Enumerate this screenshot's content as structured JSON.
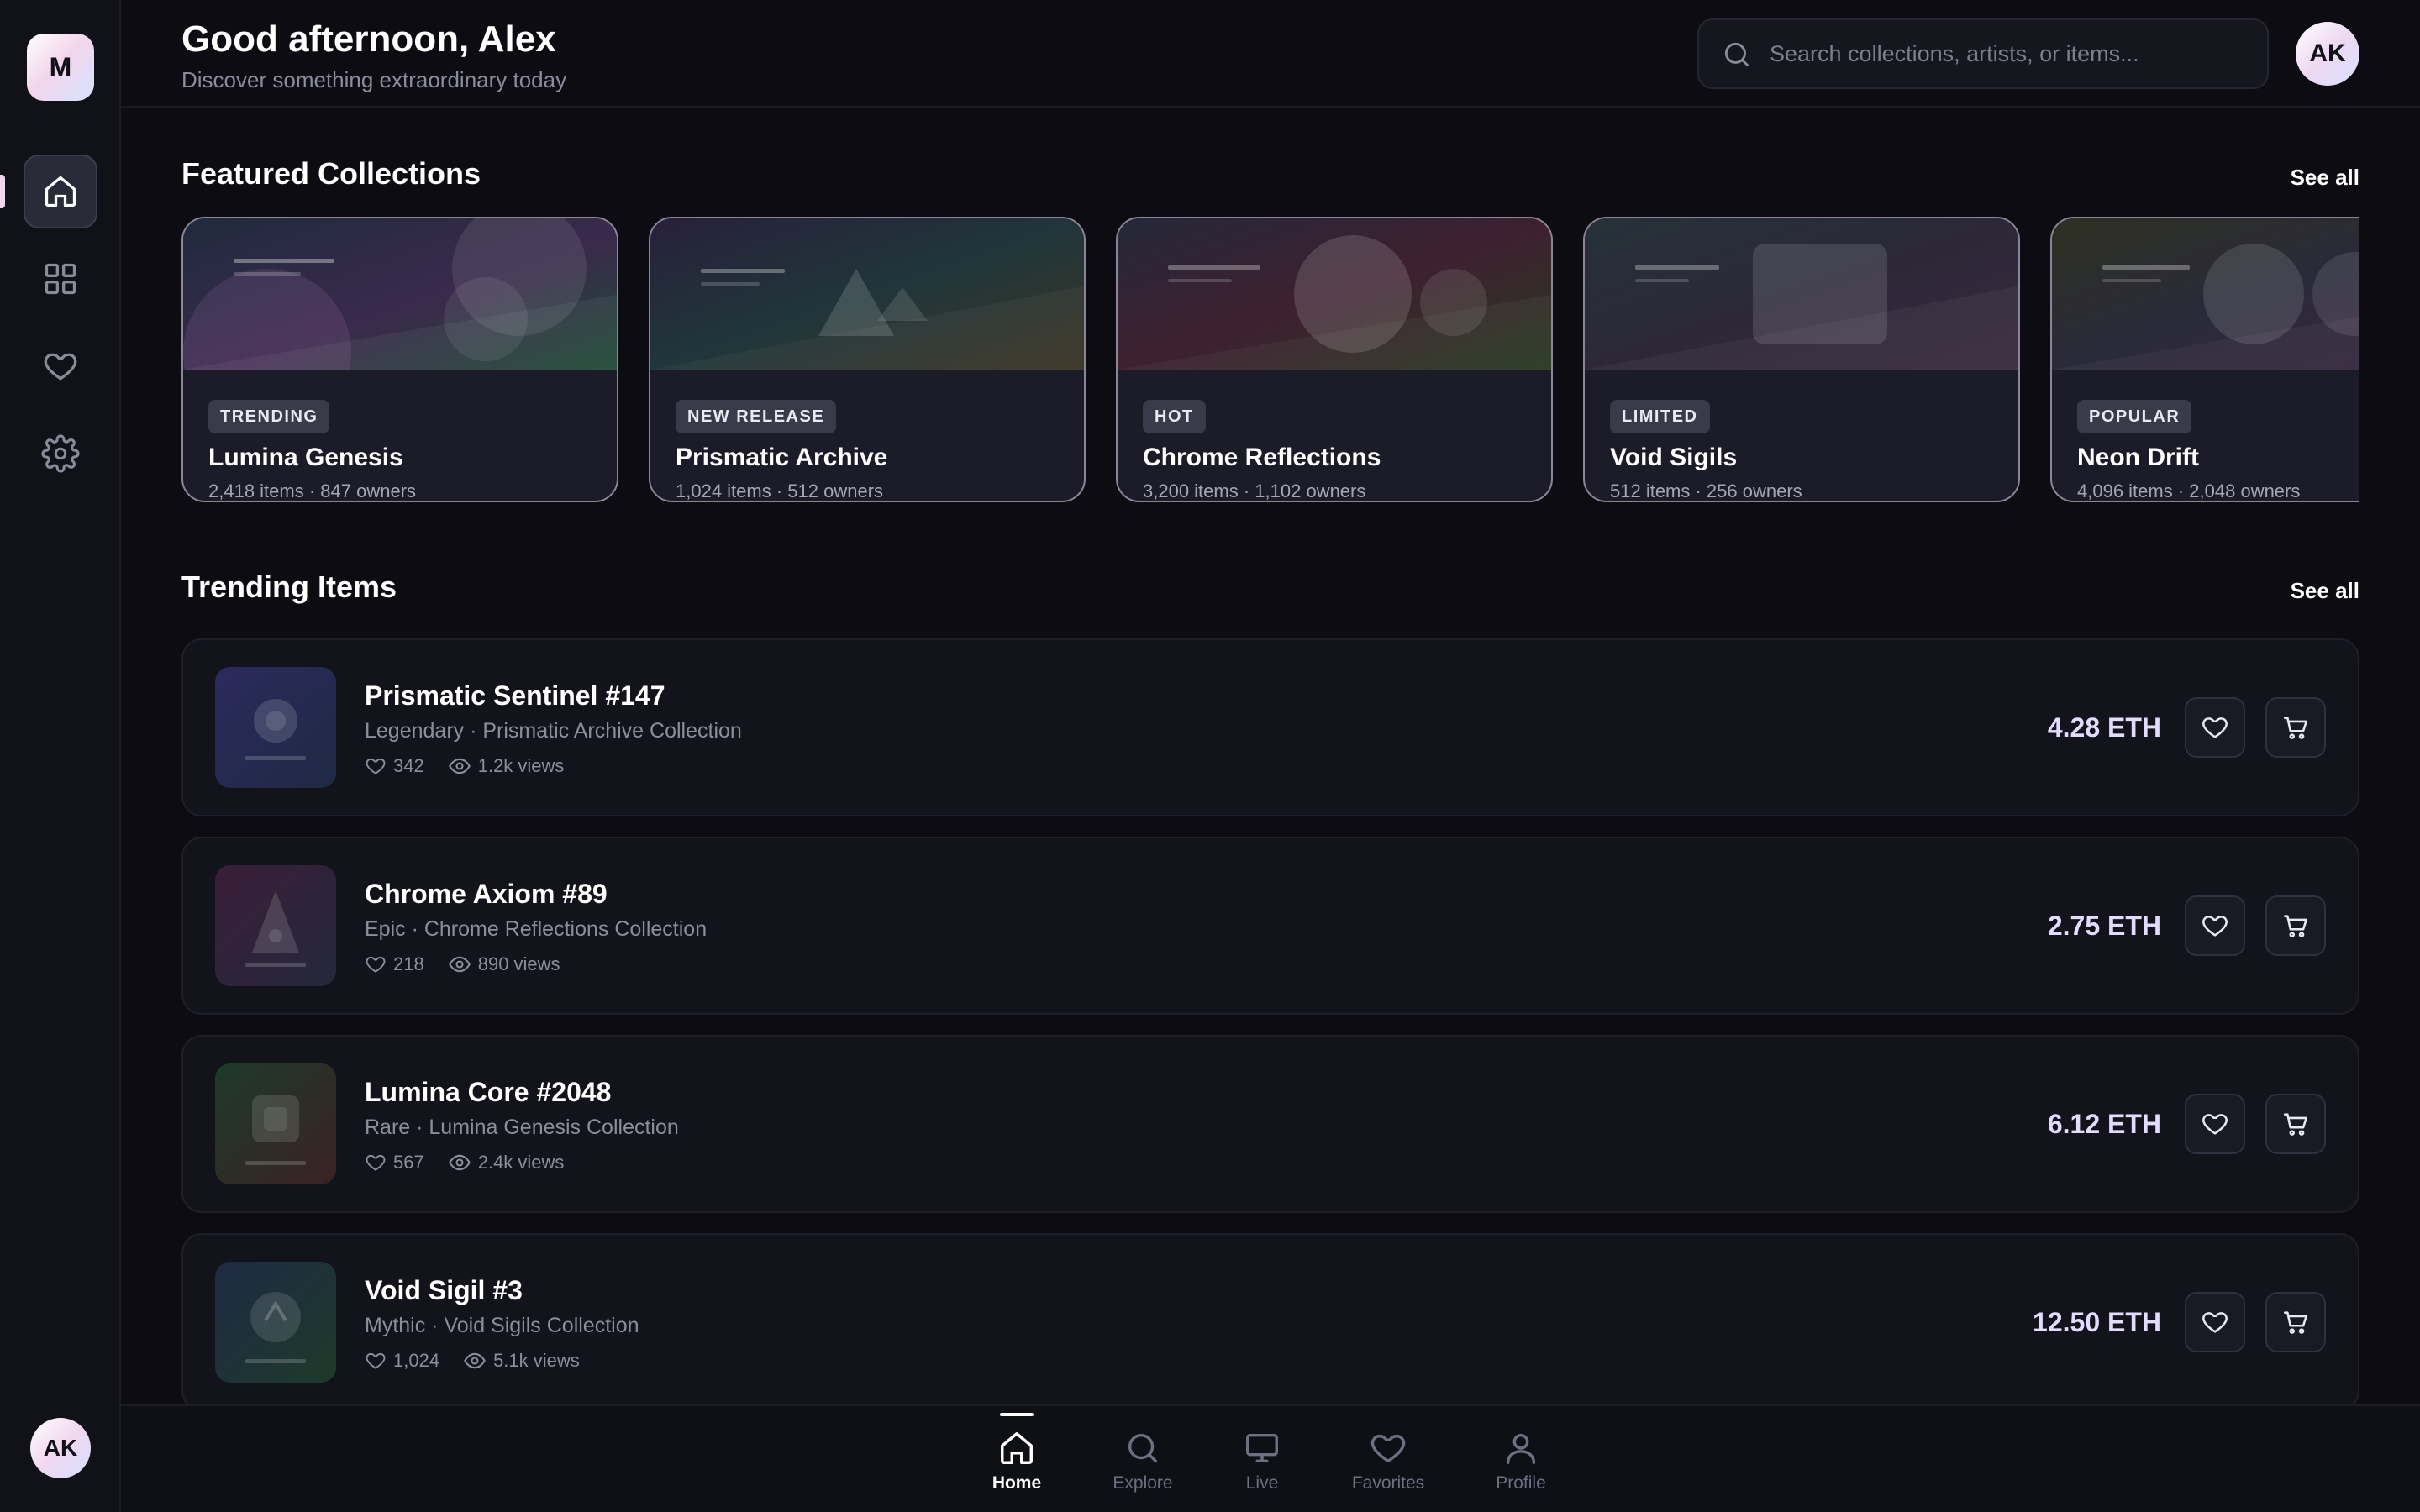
{
  "app": {
    "logo_letter": "M"
  },
  "header": {
    "greeting": "Good afternoon, Alex",
    "subtitle": "Discover something extraordinary today",
    "search_placeholder": "Search collections, artists, or items...",
    "avatar_initials": "AK"
  },
  "sidebar": {
    "items": [
      {
        "icon": "home-icon",
        "active": true
      },
      {
        "icon": "grid-icon",
        "active": false
      },
      {
        "icon": "heart-icon",
        "active": false
      },
      {
        "icon": "gear-icon",
        "active": false
      }
    ],
    "avatar_initials": "AK"
  },
  "featured": {
    "title": "Featured Collections",
    "see_all": "See all",
    "collections": [
      {
        "badge": "TRENDING",
        "name": "Lumina Genesis",
        "meta": "2,418 items · 847 owners"
      },
      {
        "badge": "NEW RELEASE",
        "name": "Prismatic Archive",
        "meta": "1,024 items · 512 owners"
      },
      {
        "badge": "HOT",
        "name": "Chrome Reflections",
        "meta": "3,200 items · 1,102 owners"
      },
      {
        "badge": "LIMITED",
        "name": "Void Sigils",
        "meta": "512 items · 256 owners"
      },
      {
        "badge": "POPULAR",
        "name": "Neon Drift",
        "meta": "4,096 items · 2,048 owners"
      }
    ]
  },
  "trending": {
    "title": "Trending Items",
    "see_all": "See all",
    "items": [
      {
        "name": "Prismatic Sentinel #147",
        "subtitle": "Legendary · Prismatic Archive Collection",
        "likes": "342",
        "views": "1.2k views",
        "price": "4.28 ETH"
      },
      {
        "name": "Chrome Axiom #89",
        "subtitle": "Epic · Chrome Reflections Collection",
        "likes": "218",
        "views": "890 views",
        "price": "2.75 ETH"
      },
      {
        "name": "Lumina Core #2048",
        "subtitle": "Rare · Lumina Genesis Collection",
        "likes": "567",
        "views": "2.4k views",
        "price": "6.12 ETH"
      },
      {
        "name": "Void Sigil #3",
        "subtitle": "Mythic · Void Sigils Collection",
        "likes": "1,024",
        "views": "5.1k views",
        "price": "12.50 ETH"
      }
    ]
  },
  "bottom_nav": {
    "tabs": [
      {
        "label": "Home",
        "icon": "home-icon",
        "active": true
      },
      {
        "label": "Explore",
        "icon": "search-icon",
        "active": false
      },
      {
        "label": "Live",
        "icon": "monitor-icon",
        "active": false
      },
      {
        "label": "Favorites",
        "icon": "heart-icon",
        "active": false
      },
      {
        "label": "Profile",
        "icon": "user-icon",
        "active": false
      }
    ]
  }
}
